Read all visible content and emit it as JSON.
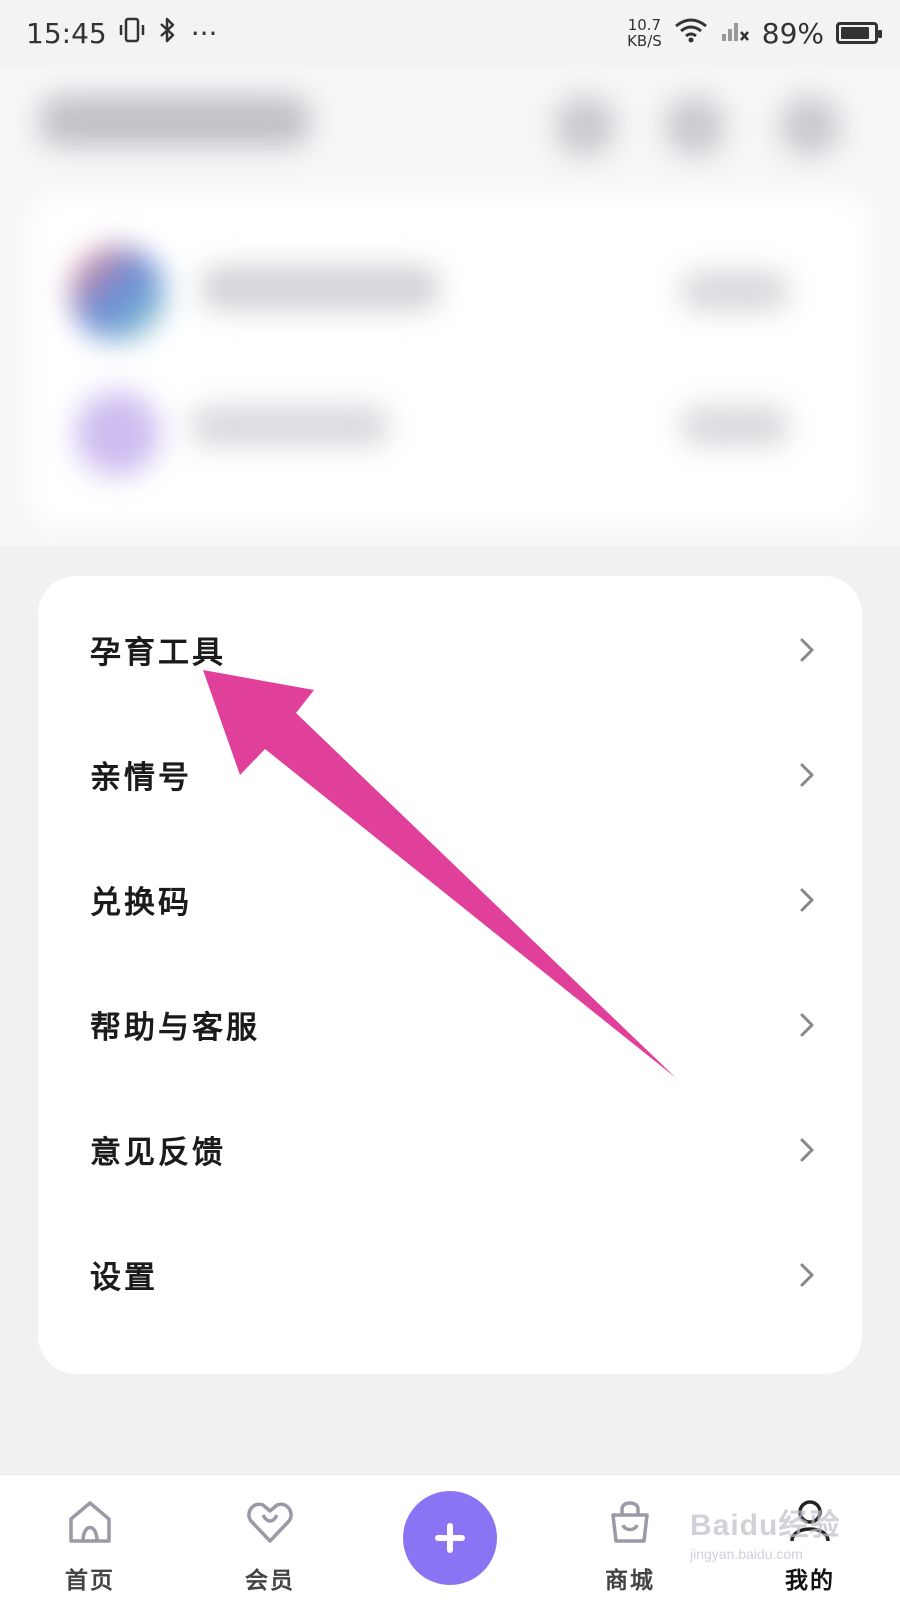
{
  "status_bar": {
    "time": "15:45",
    "more": "···",
    "speed_value": "10.7",
    "speed_unit": "KB/S",
    "battery": "89%",
    "battery_level": 0.89
  },
  "menu": {
    "items": [
      {
        "label": "孕育工具"
      },
      {
        "label": "亲情号"
      },
      {
        "label": "兑换码"
      },
      {
        "label": "帮助与客服"
      },
      {
        "label": "意见反馈"
      },
      {
        "label": "设置"
      }
    ]
  },
  "bottom_nav": {
    "home": "首页",
    "member": "会员",
    "add": "+",
    "mall": "商城",
    "mine": "我的"
  },
  "watermark": {
    "brand": "Baidu经验",
    "url": "jingyan.baidu.com"
  },
  "colors": {
    "accent": "#8a74f3",
    "annotation_arrow": "#e0409a",
    "background": "#f1f1f3",
    "card": "#ffffff"
  }
}
